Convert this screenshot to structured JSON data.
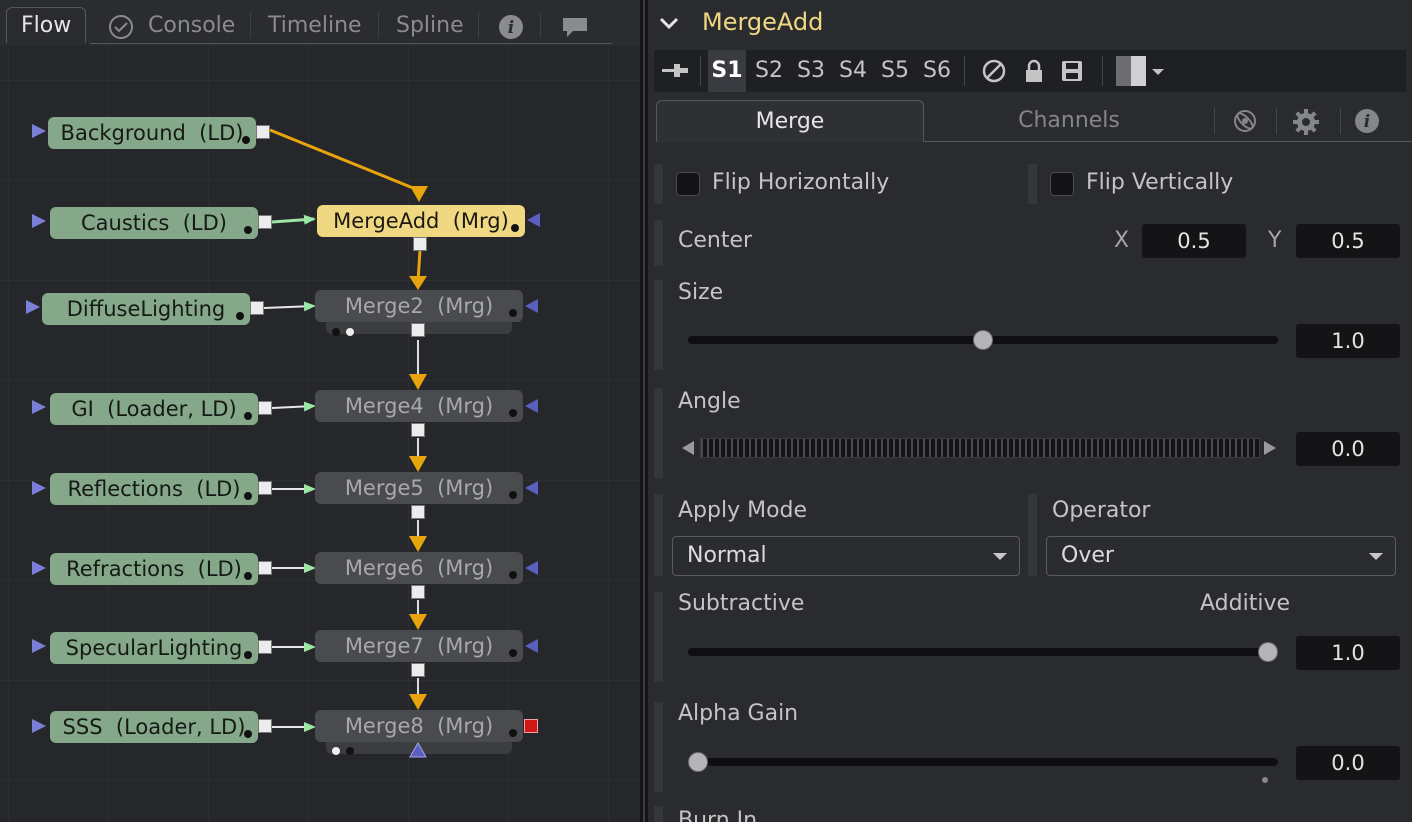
{
  "flow": {
    "tabs": [
      {
        "label": "Flow"
      },
      {
        "label": "Console"
      },
      {
        "label": "Timeline"
      },
      {
        "label": "Spline"
      }
    ],
    "loaders": [
      {
        "label": "Background  (LD)"
      },
      {
        "label": "Caustics  (LD)"
      },
      {
        "label": "DiffuseLighting"
      },
      {
        "label": "GI  (Loader, LD)"
      },
      {
        "label": "Reflections  (LD)"
      },
      {
        "label": "Refractions  (LD)"
      },
      {
        "label": "SpecularLighting"
      },
      {
        "label": "SSS  (Loader, LD)"
      }
    ],
    "merges": [
      {
        "label": "MergeAdd  (Mrg)"
      },
      {
        "label": "Merge2  (Mrg)"
      },
      {
        "label": "Merge4  (Mrg)"
      },
      {
        "label": "Merge5  (Mrg)"
      },
      {
        "label": "Merge6  (Mrg)"
      },
      {
        "label": "Merge7  (Mrg)"
      },
      {
        "label": "Merge8  (Mrg)"
      }
    ],
    "colors": {
      "loader": "#86a88a",
      "merge": "#4a4b4f",
      "active": "#f0d882",
      "link_main": "#e8a40c",
      "link_input": "#9ce6a6"
    }
  },
  "inspector": {
    "title": "MergeAdd",
    "versions": [
      "S1",
      "S2",
      "S3",
      "S4",
      "S5",
      "S6"
    ],
    "active_version": "S1",
    "toolbar_icons": [
      "pin-icon",
      "bypass-icon",
      "lock-icon",
      "save-icon",
      "color-swatch-icon"
    ],
    "tabs": [
      {
        "label": "Merge"
      },
      {
        "label": "Channels"
      }
    ],
    "tab_icons": [
      "view-3d-icon",
      "gear-icon",
      "info-icon"
    ],
    "controls": {
      "flip_horizontally": {
        "label": "Flip Horizontally",
        "checked": false
      },
      "flip_vertically": {
        "label": "Flip Vertically",
        "checked": false
      },
      "center": {
        "label": "Center",
        "x_label": "X",
        "x": "0.5",
        "y_label": "Y",
        "y": "0.5"
      },
      "size": {
        "label": "Size",
        "value": "1.0",
        "fraction": 0.5
      },
      "angle": {
        "label": "Angle",
        "value": "0.0"
      },
      "apply_mode": {
        "label": "Apply Mode",
        "value": "Normal"
      },
      "operator": {
        "label": "Operator",
        "value": "Over"
      },
      "blend": {
        "left_label": "Subtractive",
        "right_label": "Additive",
        "value": "1.0",
        "fraction": 1.0
      },
      "alpha_gain": {
        "label": "Alpha Gain",
        "value": "0.0",
        "fraction": 0.0
      },
      "burn_in": {
        "label": "Burn In"
      }
    }
  }
}
